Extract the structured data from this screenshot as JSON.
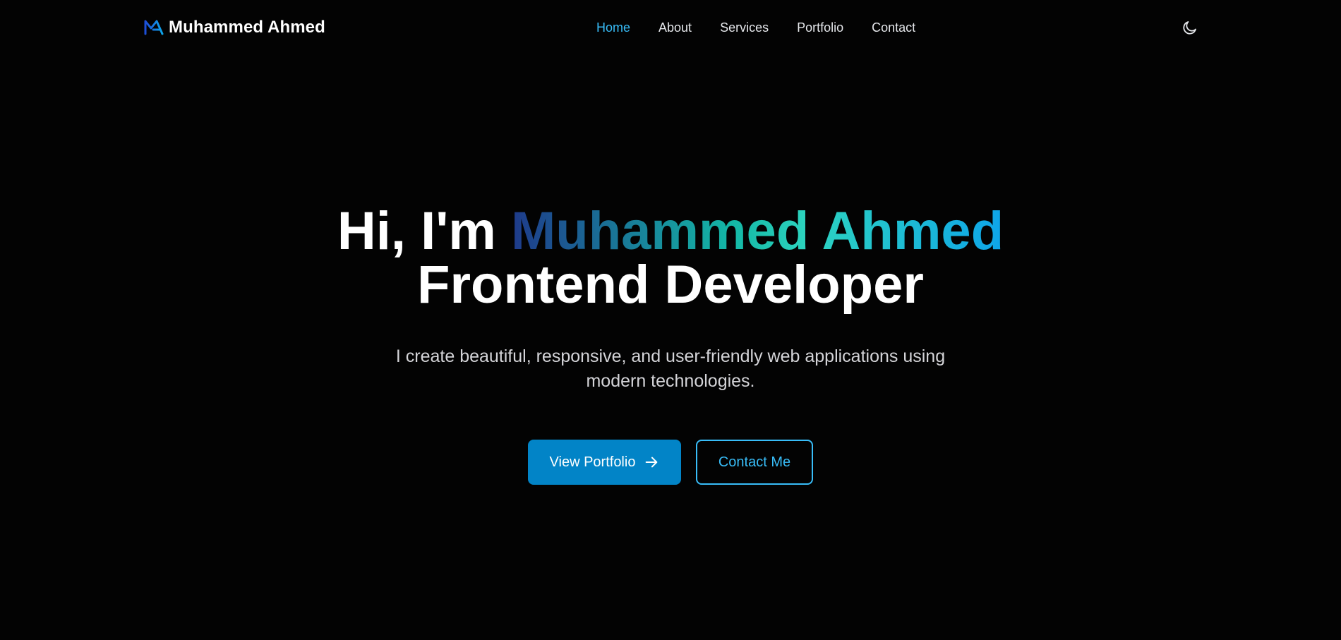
{
  "navbar": {
    "brand_name": "Muhammed Ahmed",
    "brand_logo_icon": "ma-monogram-icon",
    "links": [
      {
        "label": "Home",
        "active": true
      },
      {
        "label": "About",
        "active": false
      },
      {
        "label": "Services",
        "active": false
      },
      {
        "label": "Portfolio",
        "active": false
      },
      {
        "label": "Contact",
        "active": false
      }
    ],
    "theme_toggle_icon": "moon-icon"
  },
  "hero": {
    "greeting": "Hi, I'm",
    "name": "Muhammed Ahmed",
    "role": "Frontend Developer",
    "description": "I create beautiful, responsive, and user-friendly web applications using modern technologies.",
    "primary_button": {
      "label": "View Portfolio",
      "icon": "arrow-right-icon"
    },
    "secondary_button": {
      "label": "Contact Me"
    }
  },
  "colors": {
    "background": "#030303",
    "accent": "#38bdf8",
    "primary_button": "#0284c7",
    "name_gradient": [
      "#1e3a8a",
      "#14b8a6",
      "#2dd4bf",
      "#0ea5e9"
    ]
  }
}
